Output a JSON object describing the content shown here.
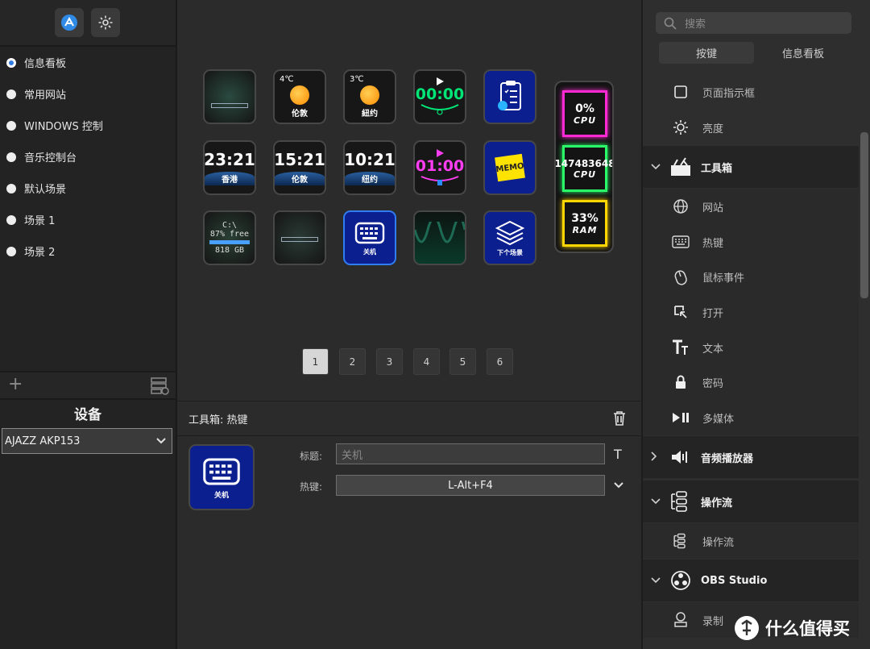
{
  "scenes": [
    {
      "label": "信息看板",
      "active": true
    },
    {
      "label": "常用网站",
      "active": false
    },
    {
      "label": "WINDOWS 控制",
      "active": false
    },
    {
      "label": "音乐控制台",
      "active": false
    },
    {
      "label": "默认场景",
      "active": false
    },
    {
      "label": "场景 1",
      "active": false
    },
    {
      "label": "场景 2",
      "active": false
    }
  ],
  "device": {
    "title": "设备",
    "selected": "AJAZZ AKP153"
  },
  "keys": {
    "weather_london": {
      "temp": "4℃",
      "city": "伦敦"
    },
    "weather_newyork": {
      "temp": "3℃",
      "city": "紐约"
    },
    "timer1": {
      "value": "00:00"
    },
    "timer2": {
      "value": "01:00"
    },
    "clock_hk": {
      "time": "23:21",
      "city": "香港"
    },
    "clock_london": {
      "time": "15:21",
      "city": "伦敦"
    },
    "clock_ny": {
      "time": "10:21",
      "city": "纽约"
    },
    "memo": {
      "label": "MEMO"
    },
    "disk": {
      "drive": "C:\\",
      "free": "87% free",
      "size": "818 GB"
    },
    "hotkey": {
      "label": "关机"
    },
    "next_scene": {
      "label": "下个场景"
    },
    "monitor": {
      "cpu1_value": "0%",
      "cpu1_name": "CPU",
      "mid_value": "147483648",
      "cpu2_name": "CPU",
      "ram_value": "33%",
      "ram_name": "RAM"
    }
  },
  "pages": [
    "1",
    "2",
    "3",
    "4",
    "5",
    "6"
  ],
  "active_page": "1",
  "properties": {
    "header": "工具箱: 热键",
    "key_label": "关机",
    "title_label": "标题:",
    "title_value": "关机",
    "hotkey_label": "热键:",
    "hotkey_value": "L-Alt+F4",
    "text_style_glyph": "T"
  },
  "right_panel": {
    "search_placeholder": "搜索",
    "tabs": [
      {
        "label": "按键",
        "active": true
      },
      {
        "label": "信息看板",
        "active": false
      }
    ],
    "items_top": [
      {
        "label": "页面指示框",
        "icon": "square-icon"
      },
      {
        "label": "亮度",
        "icon": "sun-icon"
      }
    ],
    "toolbox": {
      "label": "工具箱",
      "icon": "toolbox-icon",
      "expanded": true
    },
    "toolbox_items": [
      {
        "label": "网站",
        "icon": "globe-icon"
      },
      {
        "label": "热键",
        "icon": "keyboard-icon"
      },
      {
        "label": "鼠标事件",
        "icon": "mouse-icon"
      },
      {
        "label": "打开",
        "icon": "open-icon"
      },
      {
        "label": "文本",
        "icon": "text-icon"
      },
      {
        "label": "密码",
        "icon": "lock-icon"
      },
      {
        "label": "多媒体",
        "icon": "play-pause-icon"
      }
    ],
    "audio": {
      "label": "音频播放器",
      "icon": "speaker-icon",
      "expanded": false
    },
    "flow": {
      "label": "操作流",
      "icon": "flow-icon",
      "expanded": true
    },
    "flow_items": [
      {
        "label": "操作流",
        "icon": "flow-icon"
      }
    ],
    "obs": {
      "label": "OBS Studio",
      "icon": "obs-icon",
      "expanded": true
    },
    "obs_items": [
      {
        "label": "录制",
        "icon": "record-icon"
      }
    ]
  },
  "watermark": "什么值得买",
  "colors": {
    "accent": "#2f7de1",
    "key_blue": "#0c1f8f",
    "panel": "#2e2e2e"
  }
}
